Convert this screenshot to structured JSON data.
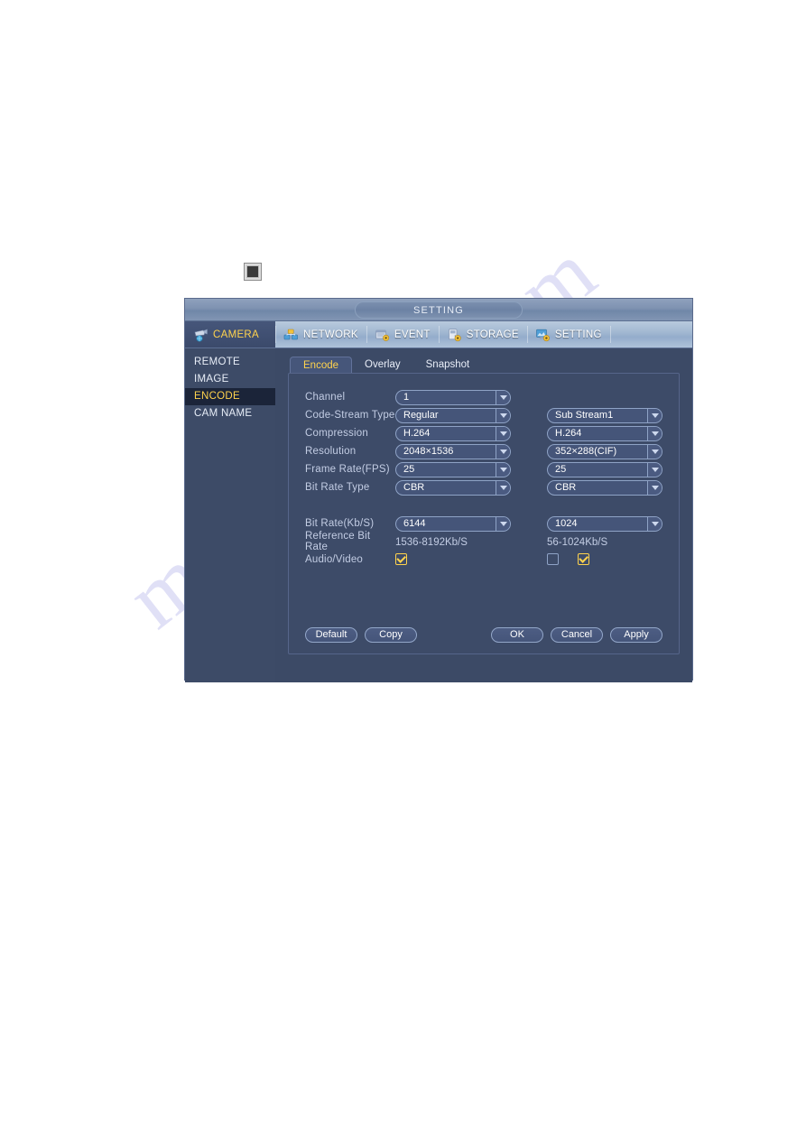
{
  "page": {
    "watermark_text": "manualslib.com",
    "chip_icon": "square-chip-icon"
  },
  "dialog": {
    "title": "SETTING",
    "menu": [
      {
        "label": "CAMERA",
        "icon": "camera-icon",
        "active": true
      },
      {
        "label": "NETWORK",
        "icon": "network-icon",
        "active": false
      },
      {
        "label": "EVENT",
        "icon": "event-icon",
        "active": false
      },
      {
        "label": "STORAGE",
        "icon": "storage-icon",
        "active": false
      },
      {
        "label": "SETTING",
        "icon": "setting-icon",
        "active": false
      }
    ],
    "sidebar": {
      "items": [
        {
          "label": "REMOTE",
          "active": false
        },
        {
          "label": "IMAGE",
          "active": false
        },
        {
          "label": "ENCODE",
          "active": true
        },
        {
          "label": "CAM NAME",
          "active": false
        }
      ]
    },
    "tabs": [
      {
        "label": "Encode",
        "active": true
      },
      {
        "label": "Overlay",
        "active": false
      },
      {
        "label": "Snapshot",
        "active": false
      }
    ],
    "form": {
      "rows": [
        {
          "label": "Channel",
          "main": "1",
          "sub": null
        },
        {
          "label": "Code-Stream Type",
          "main": "Regular",
          "sub": "Sub Stream1"
        },
        {
          "label": "Compression",
          "main": "H.264",
          "sub": "H.264"
        },
        {
          "label": "Resolution",
          "main": "2048×1536",
          "sub": "352×288(CIF)"
        },
        {
          "label": "Frame Rate(FPS)",
          "main": "25",
          "sub": "25"
        },
        {
          "label": "Bit Rate Type",
          "main": "CBR",
          "sub": "CBR"
        }
      ],
      "bit_rate": {
        "label": "Bit Rate(Kb/S)",
        "main": "6144",
        "sub": "1024"
      },
      "reference_bit_rate": {
        "label": "Reference Bit Rate",
        "main": "1536-8192Kb/S",
        "sub": "56-1024Kb/S"
      },
      "audio_video": {
        "label": "Audio/Video",
        "main_video_checked": true,
        "sub_audio_checked": false,
        "sub_video_checked": true
      }
    },
    "buttons": {
      "default": "Default",
      "copy": "Copy",
      "ok": "OK",
      "cancel": "Cancel",
      "apply": "Apply"
    },
    "colors": {
      "accent": "#ffd34d",
      "panel_bg": "#3d4b68",
      "dialog_bg": "#3c4a66",
      "label_text": "#c3cde4"
    }
  }
}
